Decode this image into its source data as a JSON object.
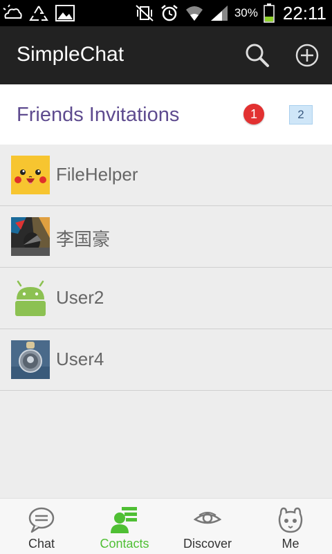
{
  "status_bar": {
    "battery_pct": "30%",
    "clock": "22:11"
  },
  "action_bar": {
    "title": "SimpleChat",
    "search_icon": "search-icon",
    "add_icon": "plus-circle-icon"
  },
  "invitations": {
    "label": "Friends Invitations",
    "badge": "1",
    "count": "2"
  },
  "contacts": [
    {
      "name": "FileHelper",
      "avatar": "pikachu-avatar"
    },
    {
      "name": "李国豪",
      "avatar": "photo-avatar"
    },
    {
      "name": "User2",
      "avatar": "android-avatar"
    },
    {
      "name": "User4",
      "avatar": "coin-avatar"
    }
  ],
  "tabs": [
    {
      "label": "Chat",
      "icon": "chat-bubble-icon",
      "active": false
    },
    {
      "label": "Contacts",
      "icon": "contacts-icon",
      "active": true
    },
    {
      "label": "Discover",
      "icon": "eye-icon",
      "active": false
    },
    {
      "label": "Me",
      "icon": "face-icon",
      "active": false
    }
  ],
  "colors": {
    "action_bar": "#222222",
    "invitation_text": "#5e4b8f",
    "badge": "#e23131",
    "active_tab": "#4fbf34"
  }
}
